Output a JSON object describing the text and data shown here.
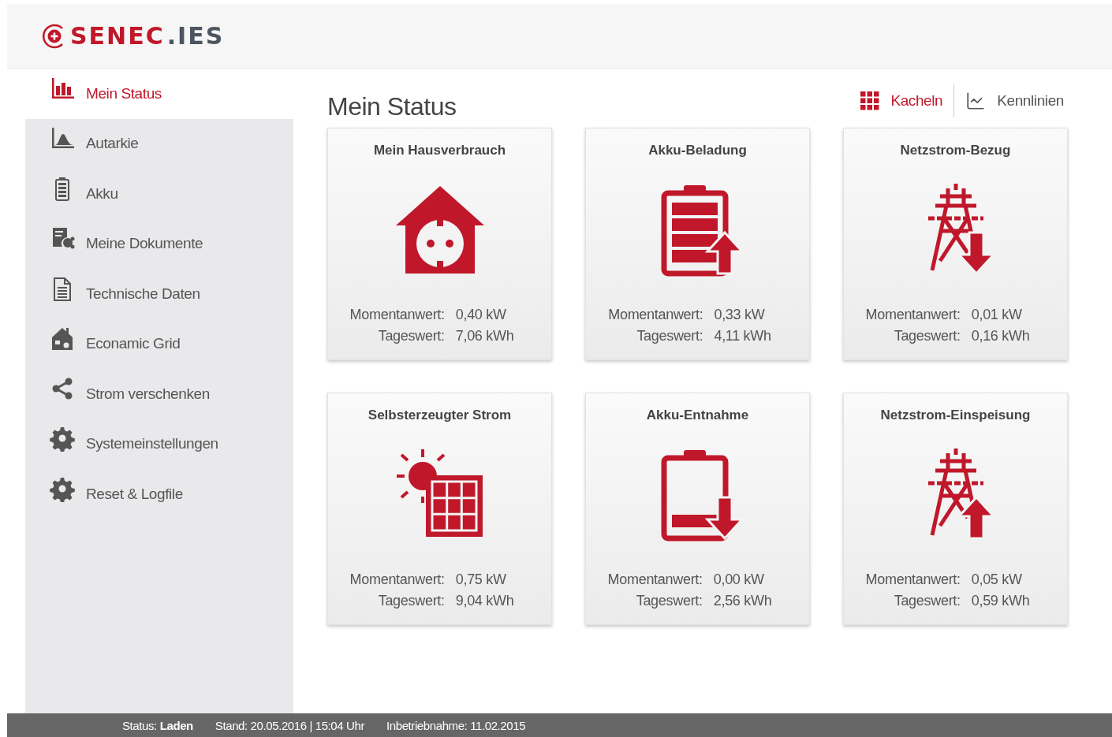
{
  "logo": {
    "mark": "SENEC",
    "suffix": ".IES"
  },
  "sidebar": {
    "items": [
      {
        "label": "Mein Status",
        "kind": "bars",
        "selected": true
      },
      {
        "label": "Autarkie",
        "kind": "curve",
        "selected": false
      },
      {
        "label": "Akku",
        "kind": "battery",
        "selected": false
      },
      {
        "label": "Meine Dokumente",
        "kind": "documents",
        "selected": false
      },
      {
        "label": "Technische Daten",
        "kind": "file",
        "selected": false
      },
      {
        "label": "Econamic Grid",
        "kind": "house",
        "selected": false
      },
      {
        "label": "Strom verschenken",
        "kind": "share",
        "selected": false
      },
      {
        "label": "Systemeinstellungen",
        "kind": "gear",
        "selected": false
      },
      {
        "label": "Reset & Logfile",
        "kind": "gear",
        "selected": false
      }
    ]
  },
  "page_title": "Mein Status",
  "view_switch": [
    {
      "label": "Kacheln",
      "kind": "tiles",
      "selected": true
    },
    {
      "label": "Kennlinien",
      "kind": "lines",
      "selected": false
    }
  ],
  "tiles": [
    {
      "title": "Mein Hausverbrauch",
      "kind": "house",
      "rows": [
        {
          "label": "Momentanwert:",
          "value": "0,40 kW"
        },
        {
          "label": "Tageswert:",
          "value": "7,06 kWh"
        }
      ]
    },
    {
      "title": "Akku-Beladung",
      "kind": "battery-up",
      "rows": [
        {
          "label": "Momentanwert:",
          "value": "0,33 kW"
        },
        {
          "label": "Tageswert:",
          "value": "4,11 kWh"
        }
      ]
    },
    {
      "title": "Netzstrom-Bezug",
      "kind": "pylon-down",
      "rows": [
        {
          "label": "Momentanwert:",
          "value": "0,01 kW"
        },
        {
          "label": "Tageswert:",
          "value": "0,16 kWh"
        }
      ]
    },
    {
      "title": "Selbsterzeugter Strom",
      "kind": "solar",
      "rows": [
        {
          "label": "Momentanwert:",
          "value": "0,75 kW"
        },
        {
          "label": "Tageswert:",
          "value": "9,04 kWh"
        }
      ]
    },
    {
      "title": "Akku-Entnahme",
      "kind": "battery-down",
      "rows": [
        {
          "label": "Momentanwert:",
          "value": "0,00 kW"
        },
        {
          "label": "Tageswert:",
          "value": "2,56 kWh"
        }
      ]
    },
    {
      "title": "Netzstrom-Einspeisung",
      "kind": "pylon-up",
      "rows": [
        {
          "label": "Momentanwert:",
          "value": "0,05 kW"
        },
        {
          "label": "Tageswert:",
          "value": "0,59 kWh"
        }
      ]
    }
  ],
  "status_bar": [
    "Status: **Laden**",
    "Stand: 20.05.2016 | 15:04 Uhr",
    "Inbetriebnahme: 11.02.2015"
  ]
}
